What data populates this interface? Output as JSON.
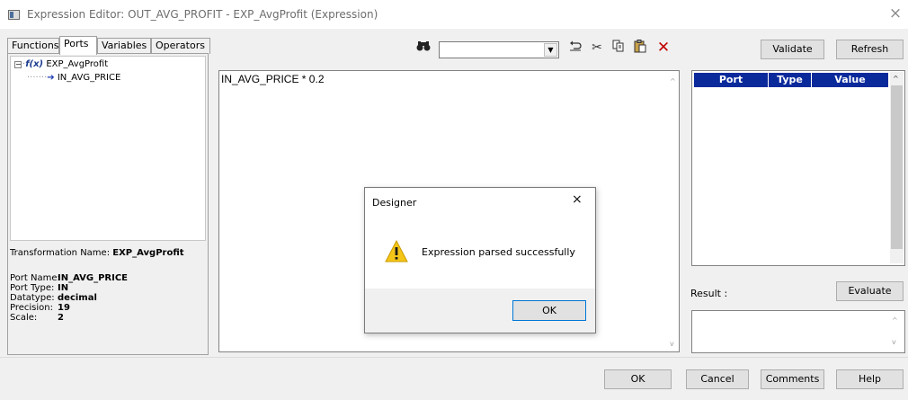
{
  "window": {
    "title": "Expression Editor: OUT_AVG_PROFIT - EXP_AvgProfit (Expression)",
    "close_glyph": "×"
  },
  "tabs": [
    {
      "label": "Functions"
    },
    {
      "label": "Ports"
    },
    {
      "label": "Variables"
    },
    {
      "label": "Operators"
    }
  ],
  "tree": {
    "root_label": "EXP_AvgProfit",
    "child_label": "IN_AVG_PRICE"
  },
  "transformation": {
    "label": "Transformation Name:",
    "value": "EXP_AvgProfit"
  },
  "port_info": [
    {
      "label": "Port Name:",
      "value": "IN_AVG_PRICE"
    },
    {
      "label": "Port Type:",
      "value": "IN"
    },
    {
      "label": "Datatype:",
      "value": "decimal"
    },
    {
      "label": "Precision:",
      "value": "19"
    },
    {
      "label": "Scale:",
      "value": "2"
    }
  ],
  "toolbar": {
    "icons": [
      "find-icon",
      "undo-icon",
      "cut-icon",
      "copy-icon",
      "paste-icon",
      "delete-icon"
    ],
    "delete_color": "#c00000",
    "search_value": ""
  },
  "buttons": {
    "validate": "Validate",
    "refresh": "Refresh",
    "evaluate": "Evaluate",
    "ok": "OK",
    "cancel": "Cancel",
    "comments": "Comments",
    "help": "Help"
  },
  "editor": {
    "expression": "IN_AVG_PRICE * 0.2"
  },
  "grid": {
    "columns": [
      "Port",
      "Type",
      "Value"
    ],
    "header_color": "#0a2a9b"
  },
  "result": {
    "label": "Result :",
    "value": ""
  },
  "dialog": {
    "title": "Designer",
    "message": "Expression parsed successfully",
    "ok": "OK",
    "close_glyph": "×",
    "icon": "warning-icon"
  }
}
